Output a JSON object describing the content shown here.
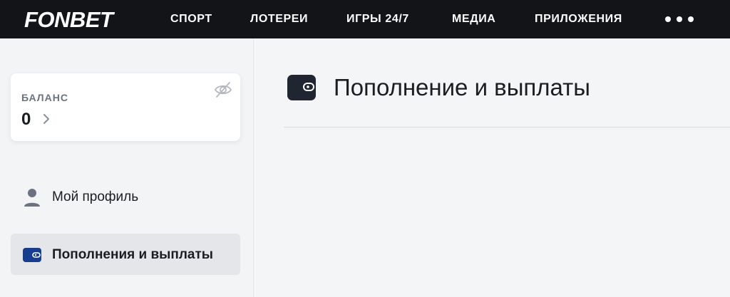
{
  "header": {
    "logo": "FONBET",
    "nav": [
      {
        "label": "СПОРТ"
      },
      {
        "label": "ЛОТЕРЕИ"
      },
      {
        "label": "ИГРЫ 24/7"
      },
      {
        "label": "МЕДИА"
      },
      {
        "label": "ПРИЛОЖЕНИЯ"
      }
    ],
    "more_icon": "more-dots-icon"
  },
  "sidebar": {
    "balance": {
      "label": "БАЛАНС",
      "value": "0",
      "visibility_icon": "eye-off-icon"
    },
    "items": [
      {
        "label": "Мой профиль",
        "icon": "user-icon",
        "active": false
      },
      {
        "label": "Пополнения и выплаты",
        "icon": "wallet-icon",
        "active": true
      }
    ]
  },
  "main": {
    "title": "Пополнение и выплаты",
    "title_icon": "wallet-icon"
  },
  "colors": {
    "topbar": "#121418",
    "active_icon": "#163e8c",
    "text": "#1b1d22"
  }
}
